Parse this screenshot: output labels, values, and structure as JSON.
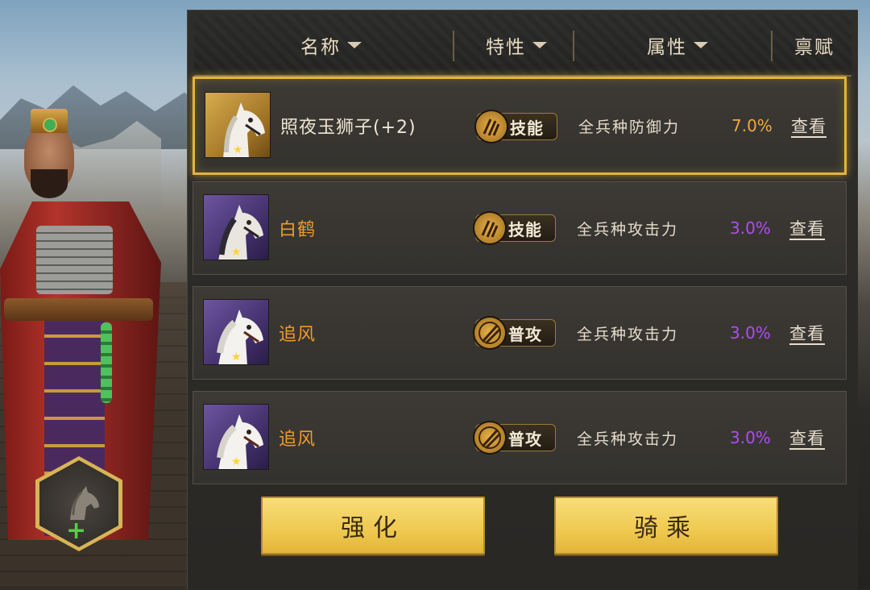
{
  "header": {
    "columns": [
      {
        "label": "名称",
        "sortable": true
      },
      {
        "label": "特性",
        "sortable": true
      },
      {
        "label": "属性",
        "sortable": true
      },
      {
        "label": "禀赋",
        "sortable": false
      }
    ]
  },
  "horses": [
    {
      "name": "照夜玉狮子(+2)",
      "name_color": "white",
      "quality": "gold",
      "stars": "★",
      "trait": "技能",
      "trait_icon": "claw-icon",
      "attribute": "全兵种防御力",
      "value": "7.0%",
      "value_color": "orange",
      "view_label": "查看",
      "selected": true
    },
    {
      "name": "白鹤",
      "name_color": "orange",
      "quality": "purple",
      "stars": "★",
      "trait": "技能",
      "trait_icon": "claw-icon",
      "attribute": "全兵种攻击力",
      "value": "3.0%",
      "value_color": "purple",
      "view_label": "查看",
      "selected": false
    },
    {
      "name": "追风",
      "name_color": "orange",
      "quality": "purple",
      "stars": "★",
      "trait": "普攻",
      "trait_icon": "slash-icon",
      "attribute": "全兵种攻击力",
      "value": "3.0%",
      "value_color": "purple",
      "view_label": "查看",
      "selected": false
    },
    {
      "name": "追风",
      "name_color": "orange",
      "quality": "purple",
      "stars": "★",
      "trait": "普攻",
      "trait_icon": "slash-icon",
      "attribute": "全兵种攻击力",
      "value": "3.0%",
      "value_color": "purple",
      "view_label": "查看",
      "selected": false
    }
  ],
  "buttons": {
    "enhance_label": "强化",
    "ride_label": "骑乘"
  },
  "mount_slot": {
    "icon": "horse-head-icon",
    "plus": "+"
  }
}
